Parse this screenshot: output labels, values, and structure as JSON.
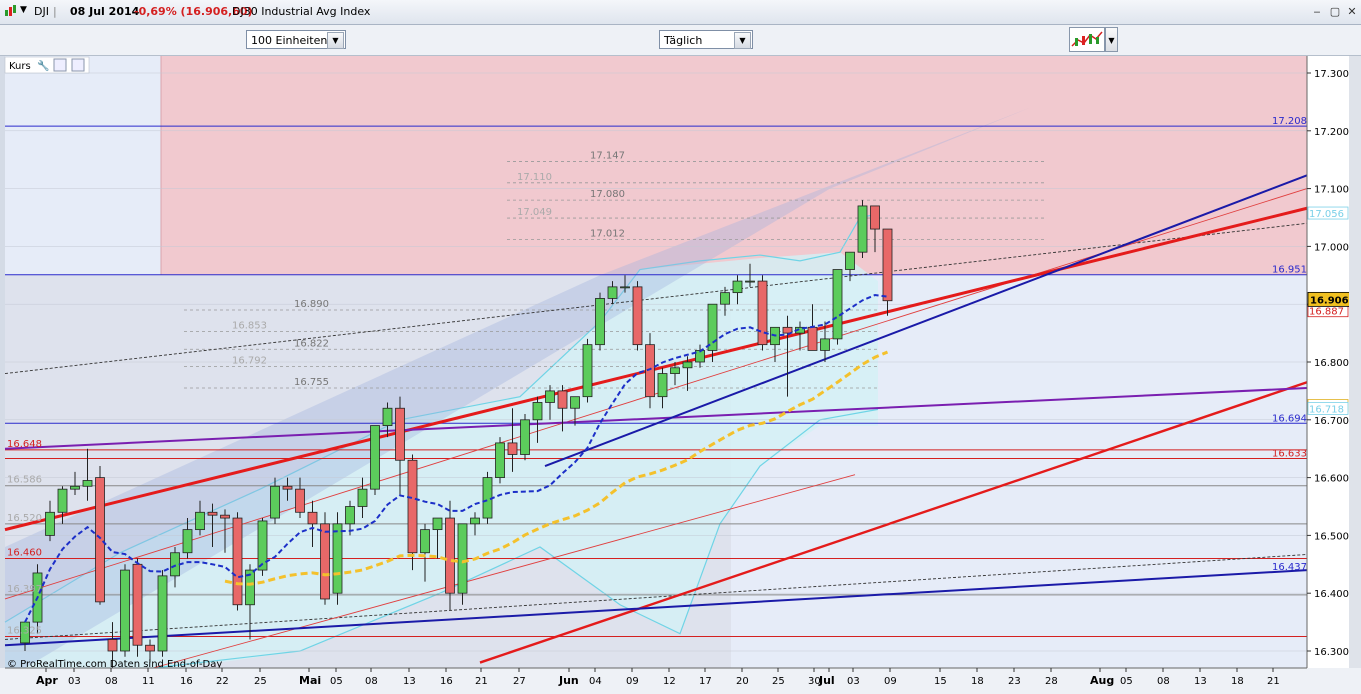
{
  "window": {
    "symbol": "DJI",
    "date": "08 Jul 2014",
    "change": "-0,69% (16.906,60)",
    "name": "DJ30 Industrial Avg Index",
    "controls": [
      "‒",
      "▢",
      "✕"
    ]
  },
  "toolbar": {
    "units_value": "100 Einheiten",
    "period_value": "Täglich"
  },
  "panel": {
    "label": "Kurs",
    "footer": "© ProRealTime.com  Daten sind End-of-Day"
  },
  "price_axis": {
    "ticks": [
      "17.300",
      "17.200",
      "17.100",
      "17.000",
      "16.900",
      "16.800",
      "16.700",
      "16.600",
      "16.500",
      "16.400",
      "16.300"
    ],
    "current_price": "16.906,60",
    "labels_right": [
      {
        "text": "17.208",
        "color": "#2a2acc"
      },
      {
        "text": "17.056",
        "color": "#7ad0e8"
      },
      {
        "text": "16.951",
        "color": "#2a2acc"
      },
      {
        "text": "16.887",
        "color": "#d42020"
      },
      {
        "text": "16.723",
        "color": "#e0b020"
      },
      {
        "text": "16.718",
        "color": "#7ad0e8"
      },
      {
        "text": "16.694",
        "color": "#2a2acc"
      },
      {
        "text": "16.633",
        "color": "#d42020"
      },
      {
        "text": "16.437",
        "color": "#2a2acc"
      }
    ]
  },
  "left_labels": [
    "16.648",
    "16.586",
    "16.520",
    "16.460",
    "16.397",
    "16.325"
  ],
  "fib_levels_upper": [
    "17.147",
    "17.110",
    "17.080",
    "17.049",
    "17.012"
  ],
  "fib_levels_lower": [
    "16.890",
    "16.853",
    "16.822",
    "16.792",
    "16.755"
  ],
  "time_axis": [
    {
      "label": "Apr",
      "major": true
    },
    {
      "label": "03"
    },
    {
      "label": "08"
    },
    {
      "label": "11"
    },
    {
      "label": "16"
    },
    {
      "label": "22"
    },
    {
      "label": "25"
    },
    {
      "label": "Mai",
      "major": true
    },
    {
      "label": "05"
    },
    {
      "label": "08"
    },
    {
      "label": "13"
    },
    {
      "label": "16"
    },
    {
      "label": "21"
    },
    {
      "label": "27"
    },
    {
      "label": "Jun",
      "major": true
    },
    {
      "label": "04"
    },
    {
      "label": "09"
    },
    {
      "label": "12"
    },
    {
      "label": "17"
    },
    {
      "label": "20"
    },
    {
      "label": "25"
    },
    {
      "label": "30"
    },
    {
      "label": "Jul",
      "major": true
    },
    {
      "label": "03"
    },
    {
      "label": "09"
    },
    {
      "label": "15"
    },
    {
      "label": "18"
    },
    {
      "label": "23"
    },
    {
      "label": "28"
    },
    {
      "label": "Aug",
      "major": true
    },
    {
      "label": "05"
    },
    {
      "label": "08"
    },
    {
      "label": "13"
    },
    {
      "label": "18"
    },
    {
      "label": "21"
    }
  ],
  "colors": {
    "bull": "#5ccc5c",
    "bear": "#e86868",
    "resistance_zone": "#f1c9cf",
    "support_zone": "#e4e8f6",
    "trend_red": "#e41b1b",
    "trend_blue": "#1a1aa8",
    "trend_purple": "#7a1fb0",
    "ma_yellow": "#f4c12c",
    "ma_blue": "#1c2fc8"
  },
  "candles": [
    [
      16314,
      16350,
      16300,
      16350
    ],
    [
      16350,
      16450,
      16330,
      16435
    ],
    [
      16500,
      16560,
      16490,
      16540
    ],
    [
      16540,
      16585,
      16520,
      16580
    ],
    [
      16580,
      16610,
      16570,
      16585
    ],
    [
      16585,
      16650,
      16560,
      16595
    ],
    [
      16600,
      16620,
      16380,
      16385
    ],
    [
      16320,
      16350,
      16250,
      16300
    ],
    [
      16300,
      16450,
      16290,
      16440
    ],
    [
      16450,
      16460,
      16290,
      16310
    ],
    [
      16310,
      16320,
      16280,
      16300
    ],
    [
      16300,
      16440,
      16290,
      16430
    ],
    [
      16430,
      16480,
      16410,
      16470
    ],
    [
      16470,
      16530,
      16460,
      16510
    ],
    [
      16510,
      16560,
      16500,
      16540
    ],
    [
      16540,
      16555,
      16480,
      16535
    ],
    [
      16535,
      16545,
      16470,
      16530
    ],
    [
      16530,
      16540,
      16370,
      16380
    ],
    [
      16380,
      16450,
      16320,
      16440
    ],
    [
      16440,
      16530,
      16430,
      16525
    ],
    [
      16530,
      16600,
      16520,
      16585
    ],
    [
      16585,
      16600,
      16560,
      16580
    ],
    [
      16580,
      16600,
      16530,
      16540
    ],
    [
      16540,
      16560,
      16480,
      16520
    ],
    [
      16520,
      16540,
      16380,
      16390
    ],
    [
      16400,
      16540,
      16380,
      16520
    ],
    [
      16520,
      16560,
      16500,
      16550
    ],
    [
      16550,
      16600,
      16530,
      16580
    ],
    [
      16580,
      16690,
      16570,
      16690
    ],
    [
      16690,
      16730,
      16670,
      16720
    ],
    [
      16720,
      16740,
      16570,
      16630
    ],
    [
      16630,
      16640,
      16440,
      16470
    ],
    [
      16470,
      16520,
      16420,
      16510
    ],
    [
      16510,
      16530,
      16460,
      16530
    ],
    [
      16530,
      16560,
      16370,
      16400
    ],
    [
      16400,
      16520,
      16380,
      16520
    ],
    [
      16520,
      16540,
      16500,
      16530
    ],
    [
      16530,
      16610,
      16520,
      16600
    ],
    [
      16600,
      16670,
      16590,
      16660
    ],
    [
      16660,
      16720,
      16610,
      16640
    ],
    [
      16640,
      16710,
      16630,
      16700
    ],
    [
      16700,
      16740,
      16660,
      16730
    ],
    [
      16730,
      16760,
      16700,
      16750
    ],
    [
      16750,
      16760,
      16680,
      16720
    ],
    [
      16720,
      16740,
      16690,
      16740
    ],
    [
      16740,
      16840,
      16730,
      16830
    ],
    [
      16830,
      16920,
      16820,
      16910
    ],
    [
      16910,
      16940,
      16900,
      16930
    ],
    [
      16930,
      16950,
      16920,
      16930
    ],
    [
      16930,
      16940,
      16820,
      16830
    ],
    [
      16830,
      16850,
      16720,
      16740
    ],
    [
      16740,
      16790,
      16720,
      16780
    ],
    [
      16780,
      16800,
      16760,
      16790
    ],
    [
      16790,
      16810,
      16750,
      16800
    ],
    [
      16800,
      16830,
      16790,
      16820
    ],
    [
      16820,
      16900,
      16800,
      16900
    ],
    [
      16900,
      16930,
      16880,
      16920
    ],
    [
      16920,
      16950,
      16900,
      16940
    ],
    [
      16940,
      16970,
      16930,
      16940
    ],
    [
      16940,
      16950,
      16820,
      16830
    ],
    [
      16830,
      16860,
      16800,
      16860
    ],
    [
      16860,
      16880,
      16740,
      16850
    ],
    [
      16850,
      16870,
      16820,
      16860
    ],
    [
      16860,
      16900,
      16820,
      16820
    ],
    [
      16820,
      16870,
      16800,
      16840
    ],
    [
      16840,
      16960,
      16830,
      16960
    ],
    [
      16960,
      16990,
      16940,
      16990
    ],
    [
      16990,
      17080,
      16980,
      17070
    ],
    [
      17070,
      17070,
      16990,
      17030
    ],
    [
      17030,
      17030,
      16880,
      16906
    ]
  ]
}
